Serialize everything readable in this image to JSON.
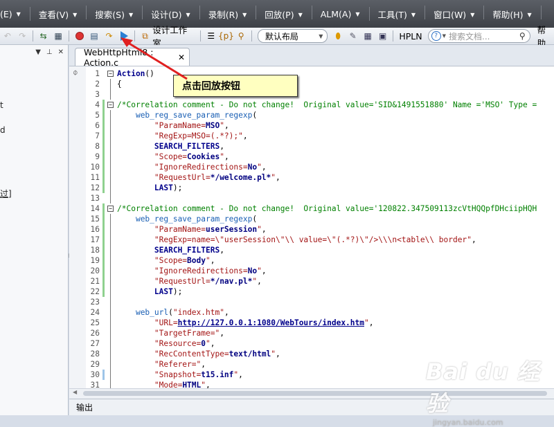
{
  "menu": [
    "(E)",
    "查看(V)",
    "搜索(S)",
    "设计(D)",
    "录制(R)",
    "回放(P)",
    "ALM(A)",
    "工具(T)",
    "窗口(W)",
    "帮助(H)"
  ],
  "toolbar": {
    "workspace_label": "设计工作室",
    "layout_combo": "默认布局",
    "hpln_label": "HPLN",
    "search_placeholder": "搜索文档...",
    "help_label": "帮助"
  },
  "left_panel": {
    "fragments": [
      "t",
      "d",
      "过]"
    ]
  },
  "tab": {
    "title": "WebHttpHtml8 : Action.c"
  },
  "code_lines": [
    "Action()",
    "{",
    "",
    "/*Correlation comment - Do not change!  Original value='SID&1491551880' Name ='MSO' Type =",
    "    web_reg_save_param_regexp(",
    "        \"ParamName=MSO\",",
    "        \"RegExp=MSO=(.*?);\",",
    "        SEARCH_FILTERS,",
    "        \"Scope=Cookies\",",
    "        \"IgnoreRedirections=No\",",
    "        \"RequestUrl=*/welcome.pl*\",",
    "        LAST);",
    "",
    "/*Correlation comment - Do not change!  Original value='120822.347509113zcVtHQQpfDHciipHQH",
    "    web_reg_save_param_regexp(",
    "        \"ParamName=userSession\",",
    "        \"RegExp=name=\\\"userSession\\\"\\\\ value=\\\"(.*?)\\\"/>\\\\\\n<table\\\\ border\",",
    "        SEARCH_FILTERS,",
    "        \"Scope=Body\",",
    "        \"IgnoreRedirections=No\",",
    "        \"RequestUrl=*/nav.pl*\",",
    "        LAST);",
    "",
    "    web_url(\"index.htm\",",
    "        \"URL=http://127.0.0.1:1080/WebTours/index.htm\",",
    "        \"TargetFrame=\",",
    "        \"Resource=0\",",
    "        \"RecContentType=text/html\",",
    "        \"Referer=\",",
    "        \"Snapshot=t15.inf\",",
    "        \"Mode=HTML\","
  ],
  "callout_text": "点击回放按钮",
  "output_label": "输出",
  "watermark": {
    "main": "Bai du 经验",
    "sub": "jingyan.baidu.com"
  },
  "colors": {
    "comment": "#008000",
    "keyword": "#00008b",
    "string": "#a31515",
    "callout_bg": "#ffffc0",
    "change_marker": "#8fd18f"
  }
}
